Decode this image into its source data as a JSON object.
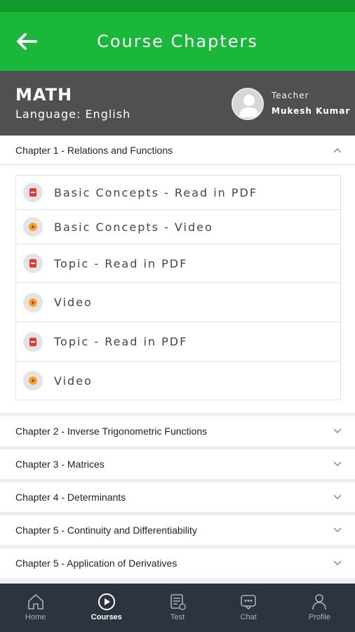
{
  "header": {
    "title": "Course Chapters"
  },
  "course": {
    "subject": "MATH",
    "language": "Language: English",
    "teacher_label": "Teacher",
    "teacher_name": "Mukesh Kumar"
  },
  "chapters": [
    {
      "title": "Chapter 1 - Relations and Functions",
      "expanded": true,
      "lessons": [
        {
          "label": "Basic Concepts - Read in PDF",
          "icon": "pdf-icon"
        },
        {
          "label": "Basic Concepts - Video",
          "icon": "play-icon"
        },
        {
          "label": "Topic - Read in PDF",
          "icon": "pdf-icon"
        },
        {
          "label": "Video",
          "icon": "play-icon"
        },
        {
          "label": "Topic - Read in PDF",
          "icon": "pdf-icon"
        },
        {
          "label": "Video",
          "icon": "play-icon"
        }
      ]
    },
    {
      "title": "Chapter 2 - Inverse Trigonometric Functions",
      "expanded": false
    },
    {
      "title": "Chapter 3 - Matrices",
      "expanded": false
    },
    {
      "title": "Chapter 4 - Determinants",
      "expanded": false
    },
    {
      "title": "Chapter 5 - Continuity and Differentiability",
      "expanded": false
    },
    {
      "title": "Chapter 5 - Application of Derivatives",
      "expanded": false
    }
  ],
  "nav": {
    "items": [
      {
        "label": "Home",
        "icon": "home-icon"
      },
      {
        "label": "Courses",
        "icon": "play-circle-icon"
      },
      {
        "label": "Test",
        "icon": "test-icon"
      },
      {
        "label": "Chat",
        "icon": "chat-icon"
      },
      {
        "label": "Profile",
        "icon": "profile-icon"
      }
    ],
    "active": "Courses"
  },
  "colors": {
    "app_bar": "#19b73a",
    "status_bar": "#119a2c",
    "course_header": "#505050",
    "bottom_nav": "#2c3440",
    "pdf_icon": "#e53935",
    "video_icon": "#f5a623"
  }
}
